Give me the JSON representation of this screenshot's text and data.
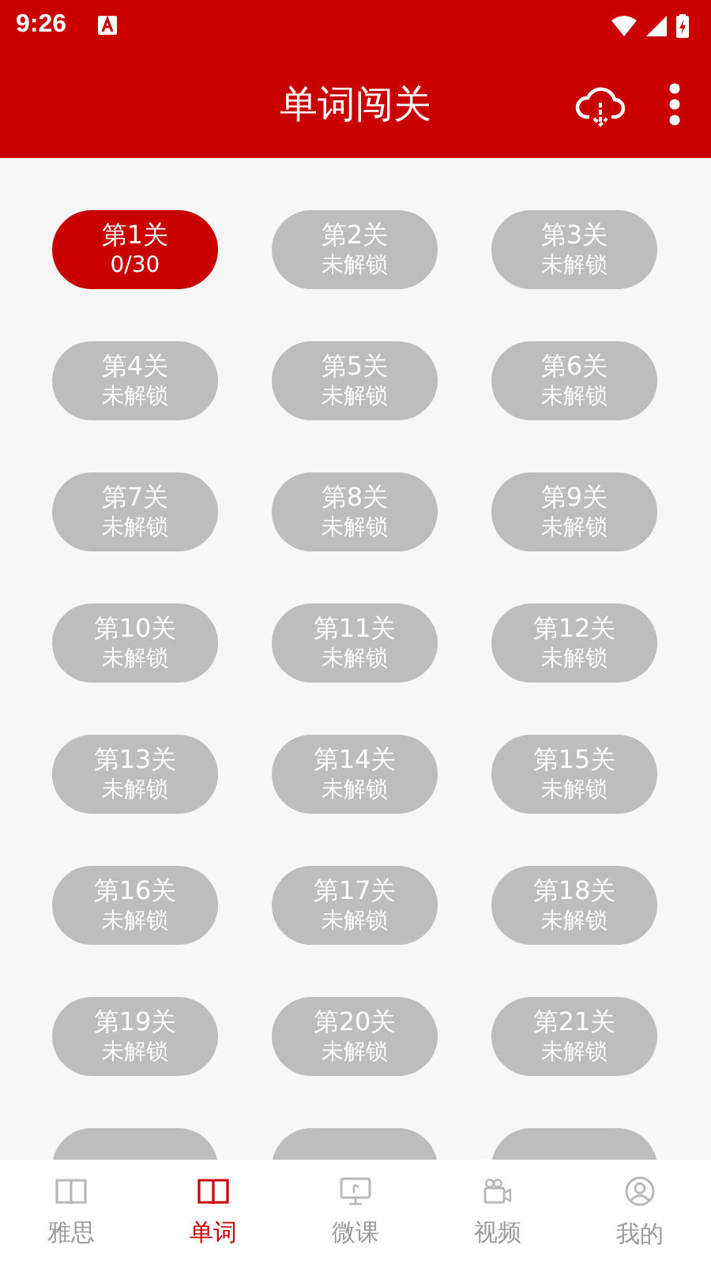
{
  "status_bar": {
    "time": "9:26"
  },
  "app_bar": {
    "title": "单词闯关"
  },
  "levels": [
    {
      "title": "第1关",
      "subtitle": "0/30",
      "unlocked": true
    },
    {
      "title": "第2关",
      "subtitle": "未解锁",
      "unlocked": false
    },
    {
      "title": "第3关",
      "subtitle": "未解锁",
      "unlocked": false
    },
    {
      "title": "第4关",
      "subtitle": "未解锁",
      "unlocked": false
    },
    {
      "title": "第5关",
      "subtitle": "未解锁",
      "unlocked": false
    },
    {
      "title": "第6关",
      "subtitle": "未解锁",
      "unlocked": false
    },
    {
      "title": "第7关",
      "subtitle": "未解锁",
      "unlocked": false
    },
    {
      "title": "第8关",
      "subtitle": "未解锁",
      "unlocked": false
    },
    {
      "title": "第9关",
      "subtitle": "未解锁",
      "unlocked": false
    },
    {
      "title": "第10关",
      "subtitle": "未解锁",
      "unlocked": false
    },
    {
      "title": "第11关",
      "subtitle": "未解锁",
      "unlocked": false
    },
    {
      "title": "第12关",
      "subtitle": "未解锁",
      "unlocked": false
    },
    {
      "title": "第13关",
      "subtitle": "未解锁",
      "unlocked": false
    },
    {
      "title": "第14关",
      "subtitle": "未解锁",
      "unlocked": false
    },
    {
      "title": "第15关",
      "subtitle": "未解锁",
      "unlocked": false
    },
    {
      "title": "第16关",
      "subtitle": "未解锁",
      "unlocked": false
    },
    {
      "title": "第17关",
      "subtitle": "未解锁",
      "unlocked": false
    },
    {
      "title": "第18关",
      "subtitle": "未解锁",
      "unlocked": false
    },
    {
      "title": "第19关",
      "subtitle": "未解锁",
      "unlocked": false
    },
    {
      "title": "第20关",
      "subtitle": "未解锁",
      "unlocked": false
    },
    {
      "title": "第21关",
      "subtitle": "未解锁",
      "unlocked": false
    },
    {
      "unlocked": false
    },
    {
      "unlocked": false
    },
    {
      "unlocked": false
    }
  ],
  "bottom_nav": [
    {
      "label": "雅思",
      "kind": "book",
      "selected": false
    },
    {
      "label": "单词",
      "kind": "book",
      "selected": true
    },
    {
      "label": "微课",
      "kind": "screen",
      "selected": false
    },
    {
      "label": "视频",
      "kind": "camera",
      "selected": false
    },
    {
      "label": "我的",
      "kind": "user",
      "selected": false
    }
  ]
}
